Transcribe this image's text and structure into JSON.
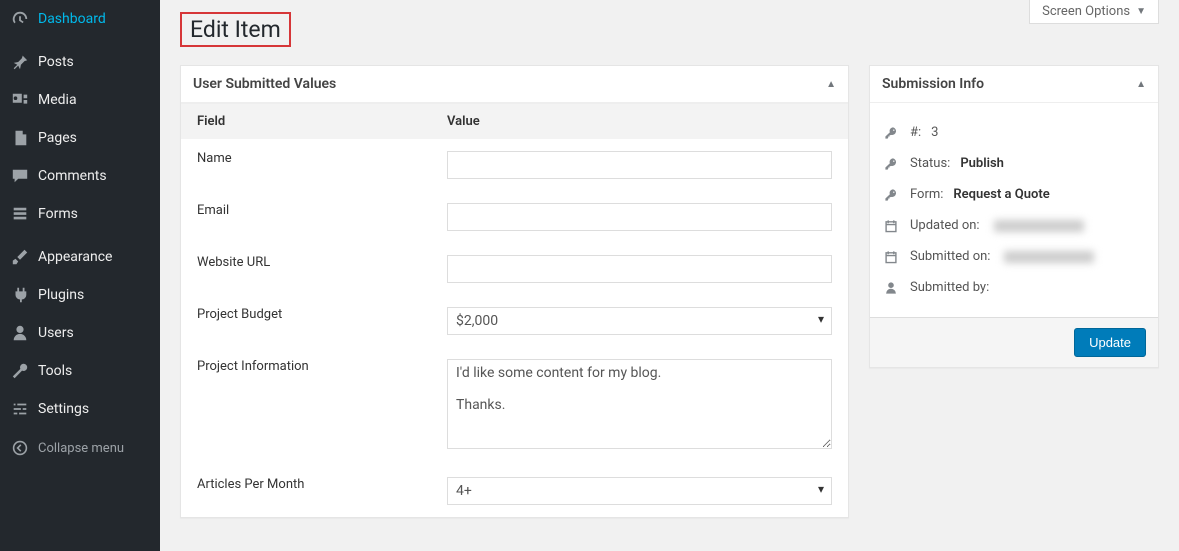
{
  "screen_options": "Screen Options",
  "page_title": "Edit Item",
  "sidebar": {
    "dashboard": "Dashboard",
    "posts": "Posts",
    "media": "Media",
    "pages": "Pages",
    "comments": "Comments",
    "forms": "Forms",
    "appearance": "Appearance",
    "plugins": "Plugins",
    "users": "Users",
    "tools": "Tools",
    "settings": "Settings",
    "collapse": "Collapse menu"
  },
  "values_panel": {
    "title": "User Submitted Values",
    "col_field": "Field",
    "col_value": "Value",
    "rows": {
      "name": {
        "label": "Name",
        "value": ""
      },
      "email": {
        "label": "Email",
        "value": ""
      },
      "website": {
        "label": "Website URL",
        "value": ""
      },
      "budget": {
        "label": "Project Budget",
        "value": "$2,000"
      },
      "info": {
        "label": "Project Information",
        "value": "I'd like some content for my blog.\n\nThanks."
      },
      "articles": {
        "label": "Articles Per Month",
        "value": "4+"
      }
    }
  },
  "submission": {
    "title": "Submission Info",
    "id_label": "#:",
    "id_value": "3",
    "status_label": "Status:",
    "status_value": "Publish",
    "form_label": "Form:",
    "form_value": "Request a Quote",
    "updated_label": "Updated on:",
    "submitted_label": "Submitted on:",
    "by_label": "Submitted by:",
    "update_btn": "Update"
  }
}
